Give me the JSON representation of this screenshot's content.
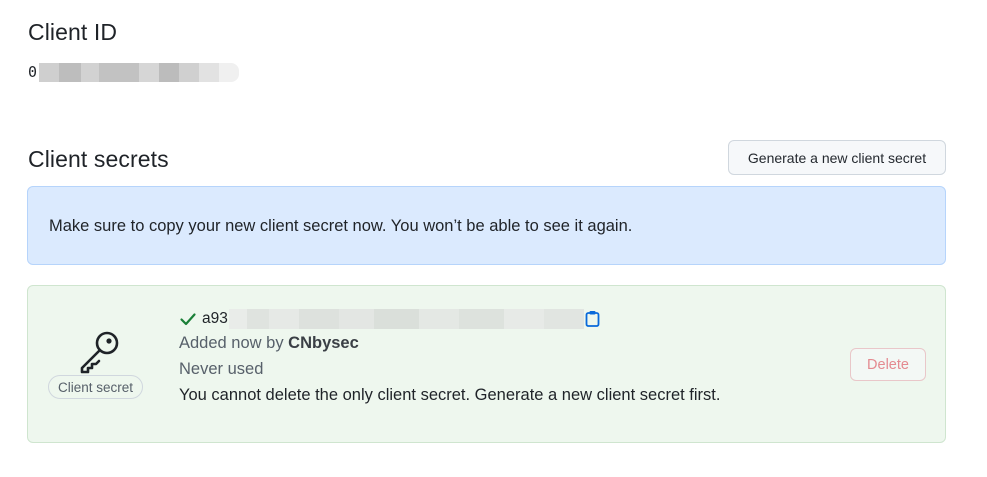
{
  "client_id": {
    "title": "Client ID",
    "value_visible_prefix": "0"
  },
  "client_secrets": {
    "title": "Client secrets",
    "generate_button_label": "Generate a new client secret",
    "flash_message": "Make sure to copy your new client secret now. You won’t be able to see it again.",
    "secret": {
      "icon_label": "Client secret",
      "value_visible_prefix": "a93",
      "added_prefix": "Added now by ",
      "added_by": "CNbysec",
      "usage": "Never used",
      "warning": "You cannot delete the only client secret. Generate a new client secret first.",
      "delete_button_label": "Delete"
    }
  },
  "icons": {
    "key": "key-icon",
    "check": "check-icon",
    "copy": "copy-icon"
  },
  "colors": {
    "flash_bg": "#dbeafe",
    "flash_border": "#b6d4fb",
    "secret_bg": "#eef7ee",
    "check": "#1a7f37",
    "copy": "#0969da",
    "delete_text": "#e48a90"
  }
}
